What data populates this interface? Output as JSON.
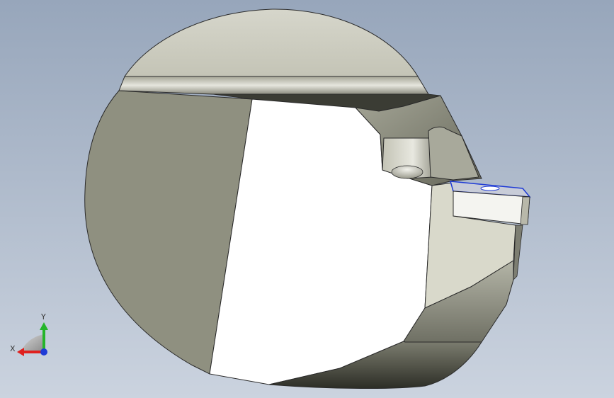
{
  "colors": {
    "background_top": "#97a6bb",
    "background_bottom": "#c9d2de",
    "axis_x": "#e0201e",
    "axis_y": "#25b52a",
    "axis_z": "#1f3bd6"
  },
  "triad": {
    "x_label": "X",
    "y_label": "Y"
  }
}
